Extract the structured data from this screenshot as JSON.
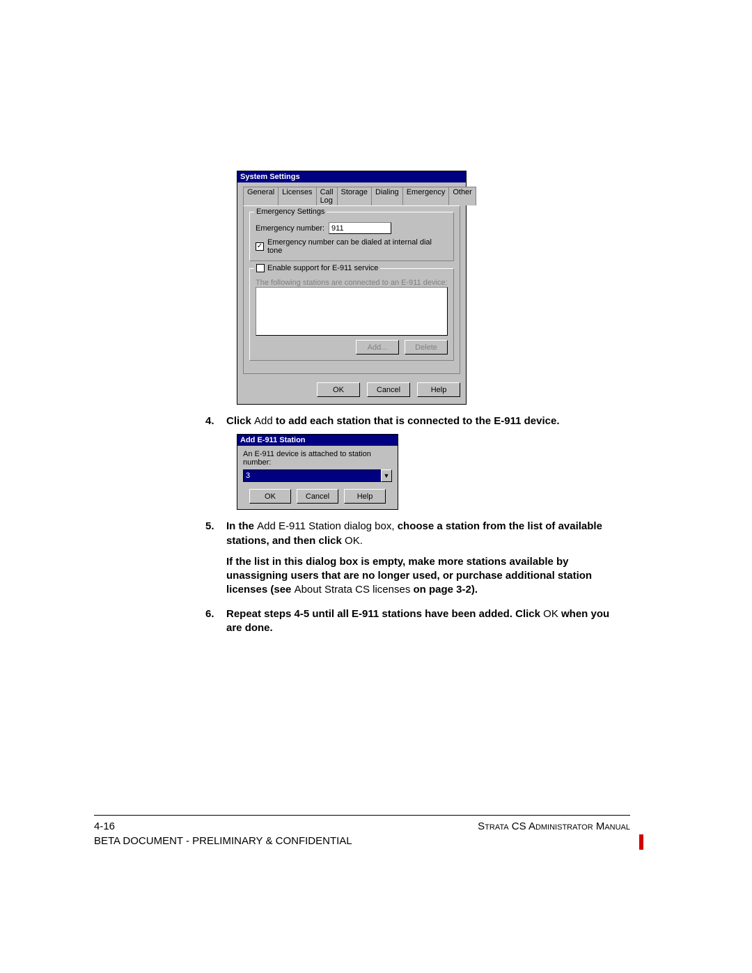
{
  "sys_dialog": {
    "title": "System Settings",
    "tabs": [
      "General",
      "Licenses",
      "Call Log",
      "Storage",
      "Dialing",
      "Emergency",
      "Other"
    ],
    "group1": {
      "legend": "Emergency Settings",
      "num_label": "Emergency number:",
      "num_value": "911",
      "chk1_checked": true,
      "chk1_label": "Emergency number can be dialed at internal dial tone"
    },
    "group2": {
      "chk_label": "Enable support for E-911 service",
      "chk_checked": false,
      "list_label": "The following stations are connected to an E-911 device:",
      "add": "Add...",
      "delete": "Delete"
    },
    "ok": "OK",
    "cancel": "Cancel",
    "help": "Help"
  },
  "add_dialog": {
    "title": "Add E-911 Station",
    "label": "An E-911 device is attached to station number:",
    "value": "3",
    "ok": "OK",
    "cancel": "Cancel",
    "help": "Help"
  },
  "steps": {
    "s4": {
      "num": "4.",
      "t1": "Click ",
      "addword": "Add",
      "t2": " to add each station that is connected to the E-911 device."
    },
    "s5": {
      "num": "5.",
      "t1": "In the ",
      "dlgname": "Add E-911 Station",
      "t2": " dialog box, ",
      "t3": "choose a station from the list of available stations, and then click ",
      "okword": "OK.",
      "p2a": "If the list in this dialog box is empty, make more stations available by unassigning users that are no longer used, or purchase additional station licenses (see ",
      "p2b": "About Strata CS licenses",
      "p2c": " on page 3-2)."
    },
    "s6": {
      "num": "6.",
      "t1": "Repeat steps 4-5 until all E-911 stations have been added. Click ",
      "okword": "OK",
      "t2": " when you are done."
    }
  },
  "footer": {
    "page": "4-16",
    "right": "Strata CS Administrator Manual",
    "line2": "BETA DOCUMENT - PRELIMINARY & CONFIDENTIAL"
  }
}
